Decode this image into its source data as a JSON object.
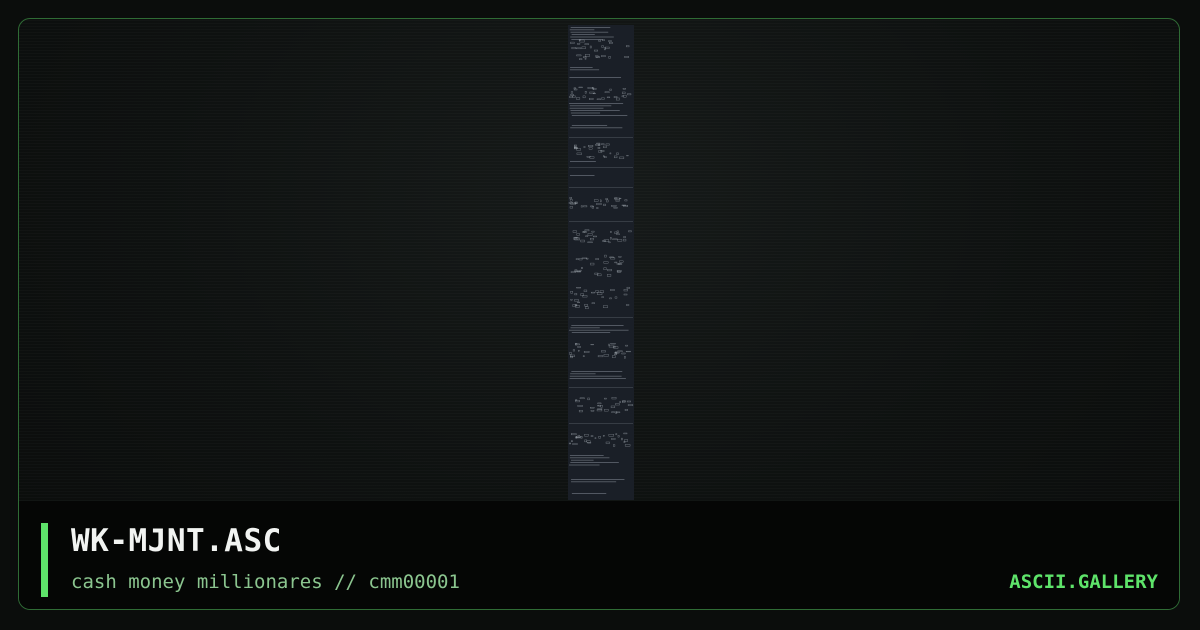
{
  "card": {
    "title": "WK-MJNT.ASC",
    "subtitle": "cash money millionares // cmm00001",
    "brand": "ASCII.GALLERY"
  },
  "colors": {
    "accent": "#5ee36a",
    "subtitle": "#8bc58f",
    "frame_border": "#2f6b35",
    "preview_bg": "#1a1f27",
    "footer_bg": "#050605"
  },
  "icons": {
    "preview": "ascii-art-thumbnail"
  }
}
